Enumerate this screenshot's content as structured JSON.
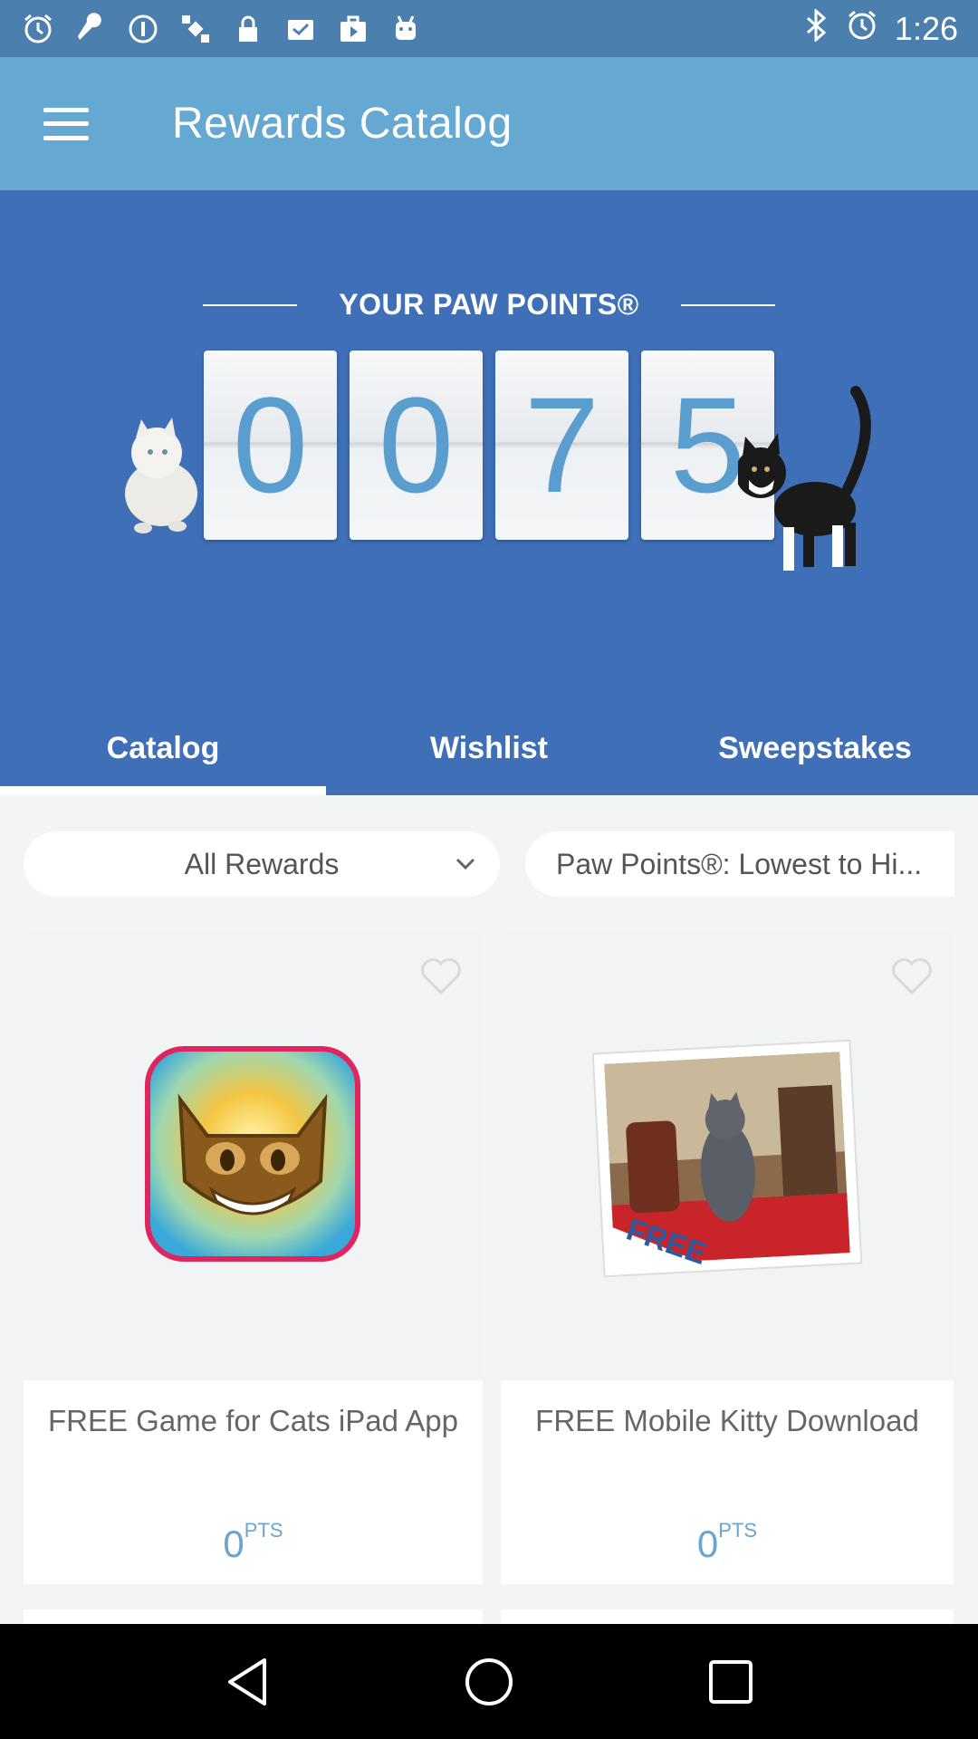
{
  "status_bar": {
    "time": "1:26",
    "left_icons": [
      "alarm-icon",
      "wrench-icon",
      "info-icon",
      "satellite-icon",
      "lock-icon",
      "inbox-icon",
      "briefcase-play-icon",
      "android-icon"
    ],
    "right_icons": [
      "bluetooth-icon",
      "alarm-icon"
    ]
  },
  "app_bar": {
    "title": "Rewards Catalog",
    "menu_icon": "hamburger-menu-icon"
  },
  "hero": {
    "points_label": "YOUR PAW POINTS®",
    "digits": [
      "0",
      "0",
      "7",
      "5"
    ]
  },
  "tabs": [
    {
      "label": "Catalog",
      "active": true
    },
    {
      "label": "Wishlist",
      "active": false
    },
    {
      "label": "Sweepstakes",
      "active": false
    }
  ],
  "filters": {
    "category": "All Rewards",
    "sort": "Paw Points®: Lowest to Hi..."
  },
  "cards": [
    {
      "title": "FREE Game for Cats iPad App",
      "points": "0",
      "unit": "PTS"
    },
    {
      "title": "FREE Mobile Kitty Download",
      "points": "0",
      "unit": "PTS",
      "image_badge": "FREE"
    }
  ],
  "colors": {
    "status_bar": "#4b7fae",
    "app_bar": "#65a8d2",
    "hero": "#3f6fb7",
    "digit_text": "#5a9ed0",
    "points_text": "#6da4cf"
  }
}
